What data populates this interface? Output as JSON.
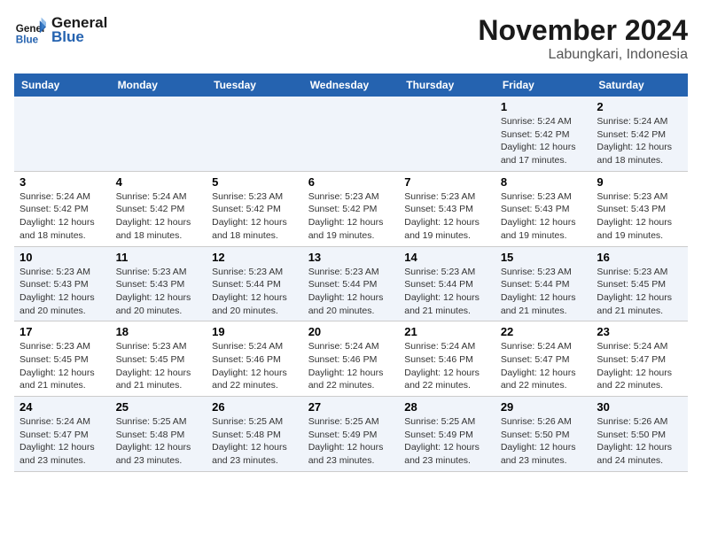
{
  "logo": {
    "line1": "General",
    "line2": "Blue"
  },
  "title": "November 2024",
  "subtitle": "Labungkari, Indonesia",
  "days_of_week": [
    "Sunday",
    "Monday",
    "Tuesday",
    "Wednesday",
    "Thursday",
    "Friday",
    "Saturday"
  ],
  "weeks": [
    [
      {
        "day": "",
        "info": ""
      },
      {
        "day": "",
        "info": ""
      },
      {
        "day": "",
        "info": ""
      },
      {
        "day": "",
        "info": ""
      },
      {
        "day": "",
        "info": ""
      },
      {
        "day": "1",
        "info": "Sunrise: 5:24 AM\nSunset: 5:42 PM\nDaylight: 12 hours and 17 minutes."
      },
      {
        "day": "2",
        "info": "Sunrise: 5:24 AM\nSunset: 5:42 PM\nDaylight: 12 hours and 18 minutes."
      }
    ],
    [
      {
        "day": "3",
        "info": "Sunrise: 5:24 AM\nSunset: 5:42 PM\nDaylight: 12 hours and 18 minutes."
      },
      {
        "day": "4",
        "info": "Sunrise: 5:24 AM\nSunset: 5:42 PM\nDaylight: 12 hours and 18 minutes."
      },
      {
        "day": "5",
        "info": "Sunrise: 5:23 AM\nSunset: 5:42 PM\nDaylight: 12 hours and 18 minutes."
      },
      {
        "day": "6",
        "info": "Sunrise: 5:23 AM\nSunset: 5:42 PM\nDaylight: 12 hours and 19 minutes."
      },
      {
        "day": "7",
        "info": "Sunrise: 5:23 AM\nSunset: 5:43 PM\nDaylight: 12 hours and 19 minutes."
      },
      {
        "day": "8",
        "info": "Sunrise: 5:23 AM\nSunset: 5:43 PM\nDaylight: 12 hours and 19 minutes."
      },
      {
        "day": "9",
        "info": "Sunrise: 5:23 AM\nSunset: 5:43 PM\nDaylight: 12 hours and 19 minutes."
      }
    ],
    [
      {
        "day": "10",
        "info": "Sunrise: 5:23 AM\nSunset: 5:43 PM\nDaylight: 12 hours and 20 minutes."
      },
      {
        "day": "11",
        "info": "Sunrise: 5:23 AM\nSunset: 5:43 PM\nDaylight: 12 hours and 20 minutes."
      },
      {
        "day": "12",
        "info": "Sunrise: 5:23 AM\nSunset: 5:44 PM\nDaylight: 12 hours and 20 minutes."
      },
      {
        "day": "13",
        "info": "Sunrise: 5:23 AM\nSunset: 5:44 PM\nDaylight: 12 hours and 20 minutes."
      },
      {
        "day": "14",
        "info": "Sunrise: 5:23 AM\nSunset: 5:44 PM\nDaylight: 12 hours and 21 minutes."
      },
      {
        "day": "15",
        "info": "Sunrise: 5:23 AM\nSunset: 5:44 PM\nDaylight: 12 hours and 21 minutes."
      },
      {
        "day": "16",
        "info": "Sunrise: 5:23 AM\nSunset: 5:45 PM\nDaylight: 12 hours and 21 minutes."
      }
    ],
    [
      {
        "day": "17",
        "info": "Sunrise: 5:23 AM\nSunset: 5:45 PM\nDaylight: 12 hours and 21 minutes."
      },
      {
        "day": "18",
        "info": "Sunrise: 5:23 AM\nSunset: 5:45 PM\nDaylight: 12 hours and 21 minutes."
      },
      {
        "day": "19",
        "info": "Sunrise: 5:24 AM\nSunset: 5:46 PM\nDaylight: 12 hours and 22 minutes."
      },
      {
        "day": "20",
        "info": "Sunrise: 5:24 AM\nSunset: 5:46 PM\nDaylight: 12 hours and 22 minutes."
      },
      {
        "day": "21",
        "info": "Sunrise: 5:24 AM\nSunset: 5:46 PM\nDaylight: 12 hours and 22 minutes."
      },
      {
        "day": "22",
        "info": "Sunrise: 5:24 AM\nSunset: 5:47 PM\nDaylight: 12 hours and 22 minutes."
      },
      {
        "day": "23",
        "info": "Sunrise: 5:24 AM\nSunset: 5:47 PM\nDaylight: 12 hours and 22 minutes."
      }
    ],
    [
      {
        "day": "24",
        "info": "Sunrise: 5:24 AM\nSunset: 5:47 PM\nDaylight: 12 hours and 23 minutes."
      },
      {
        "day": "25",
        "info": "Sunrise: 5:25 AM\nSunset: 5:48 PM\nDaylight: 12 hours and 23 minutes."
      },
      {
        "day": "26",
        "info": "Sunrise: 5:25 AM\nSunset: 5:48 PM\nDaylight: 12 hours and 23 minutes."
      },
      {
        "day": "27",
        "info": "Sunrise: 5:25 AM\nSunset: 5:49 PM\nDaylight: 12 hours and 23 minutes."
      },
      {
        "day": "28",
        "info": "Sunrise: 5:25 AM\nSunset: 5:49 PM\nDaylight: 12 hours and 23 minutes."
      },
      {
        "day": "29",
        "info": "Sunrise: 5:26 AM\nSunset: 5:50 PM\nDaylight: 12 hours and 23 minutes."
      },
      {
        "day": "30",
        "info": "Sunrise: 5:26 AM\nSunset: 5:50 PM\nDaylight: 12 hours and 24 minutes."
      }
    ]
  ]
}
